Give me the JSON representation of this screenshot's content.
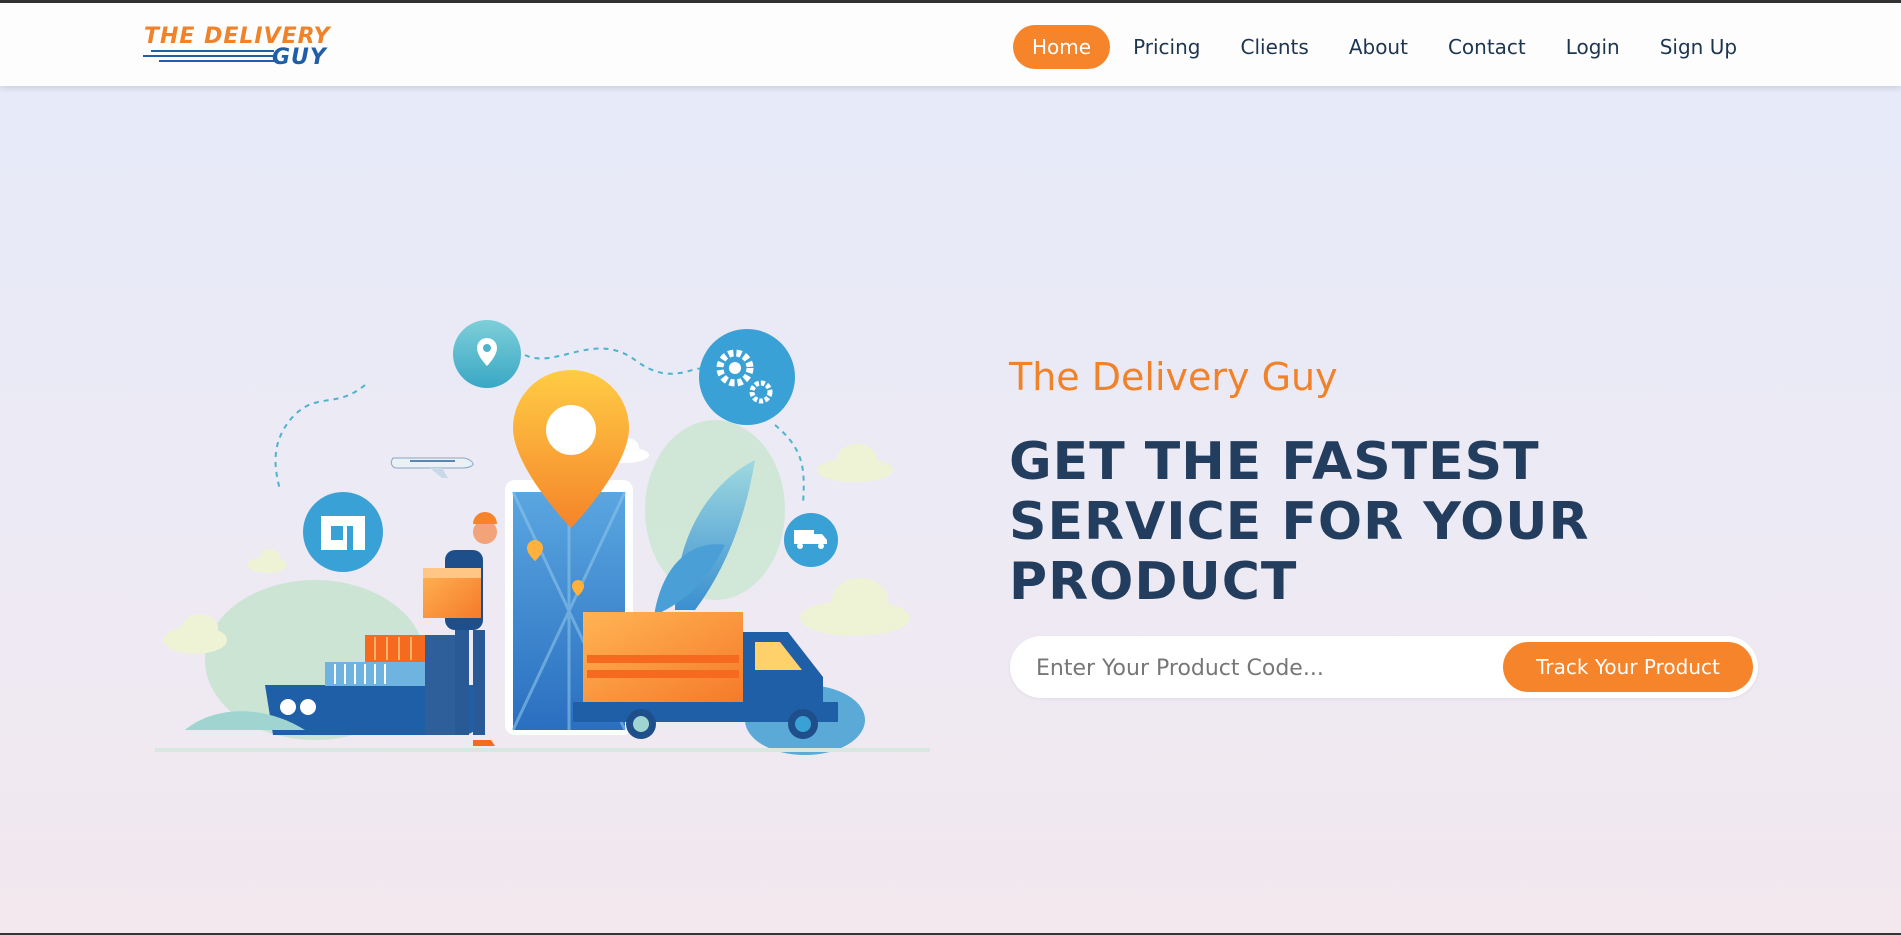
{
  "brand": {
    "logo_line1": "THE DELIVERY",
    "logo_line2": "GUY",
    "primary_color": "#f5842a",
    "secondary_color": "#1f5fa8"
  },
  "nav": {
    "items": [
      {
        "label": "Home",
        "active": true
      },
      {
        "label": "Pricing",
        "active": false
      },
      {
        "label": "Clients",
        "active": false
      },
      {
        "label": "About",
        "active": false
      },
      {
        "label": "Contact",
        "active": false
      },
      {
        "label": "Login",
        "active": false
      },
      {
        "label": "Sign Up",
        "active": false
      }
    ]
  },
  "hero": {
    "subtitle": "The Delivery Guy",
    "title": "GET THE FASTEST SERVICE FOR YOUR PRODUCT",
    "title_color": "#233d5e",
    "search": {
      "placeholder": "Enter Your Product Code...",
      "value": "",
      "button_label": "Track Your Product"
    },
    "illustration": {
      "icons": [
        "location-pin-icon",
        "gears-icon",
        "box-icon",
        "truck-icon",
        "airplane-icon"
      ]
    }
  }
}
